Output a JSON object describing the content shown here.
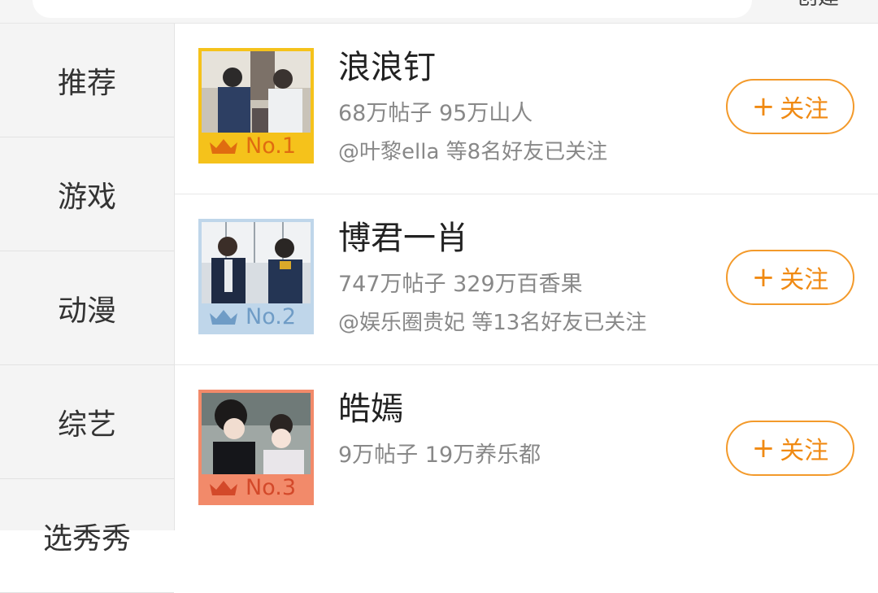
{
  "header": {
    "create_label": "创建"
  },
  "sidebar": {
    "items": [
      {
        "label": "推荐"
      },
      {
        "label": "游戏"
      },
      {
        "label": "动漫"
      },
      {
        "label": "综艺"
      },
      {
        "label": "选秀秀"
      }
    ]
  },
  "list": {
    "rows": [
      {
        "name": "浪浪钉",
        "stats": "68万帖子 95万山人",
        "friends": "@叶黎ella 等8名好友已关注",
        "rank": "No.1",
        "rank_color": "#f5c21b",
        "rank_text_color": "#e06c10",
        "follow_label": "关注"
      },
      {
        "name": "博君一肖",
        "stats": "747万帖子 329万百香果",
        "friends": "@娱乐圈贵妃 等13名好友已关注",
        "rank": "No.2",
        "rank_color": "#bfd6ea",
        "rank_text_color": "#6f9cc6",
        "follow_label": "关注"
      },
      {
        "name": "皓嫣",
        "stats": "9万帖子 19万养乐都",
        "friends": "",
        "rank": "No.3",
        "rank_color": "#f28a6a",
        "rank_text_color": "#d3492a",
        "follow_label": "关注"
      }
    ]
  },
  "icons": {
    "crown": "crown-icon",
    "plus": "plus-icon"
  },
  "colors": {
    "accent": "#f08a13",
    "sidebar_bg": "#f4f4f4"
  }
}
